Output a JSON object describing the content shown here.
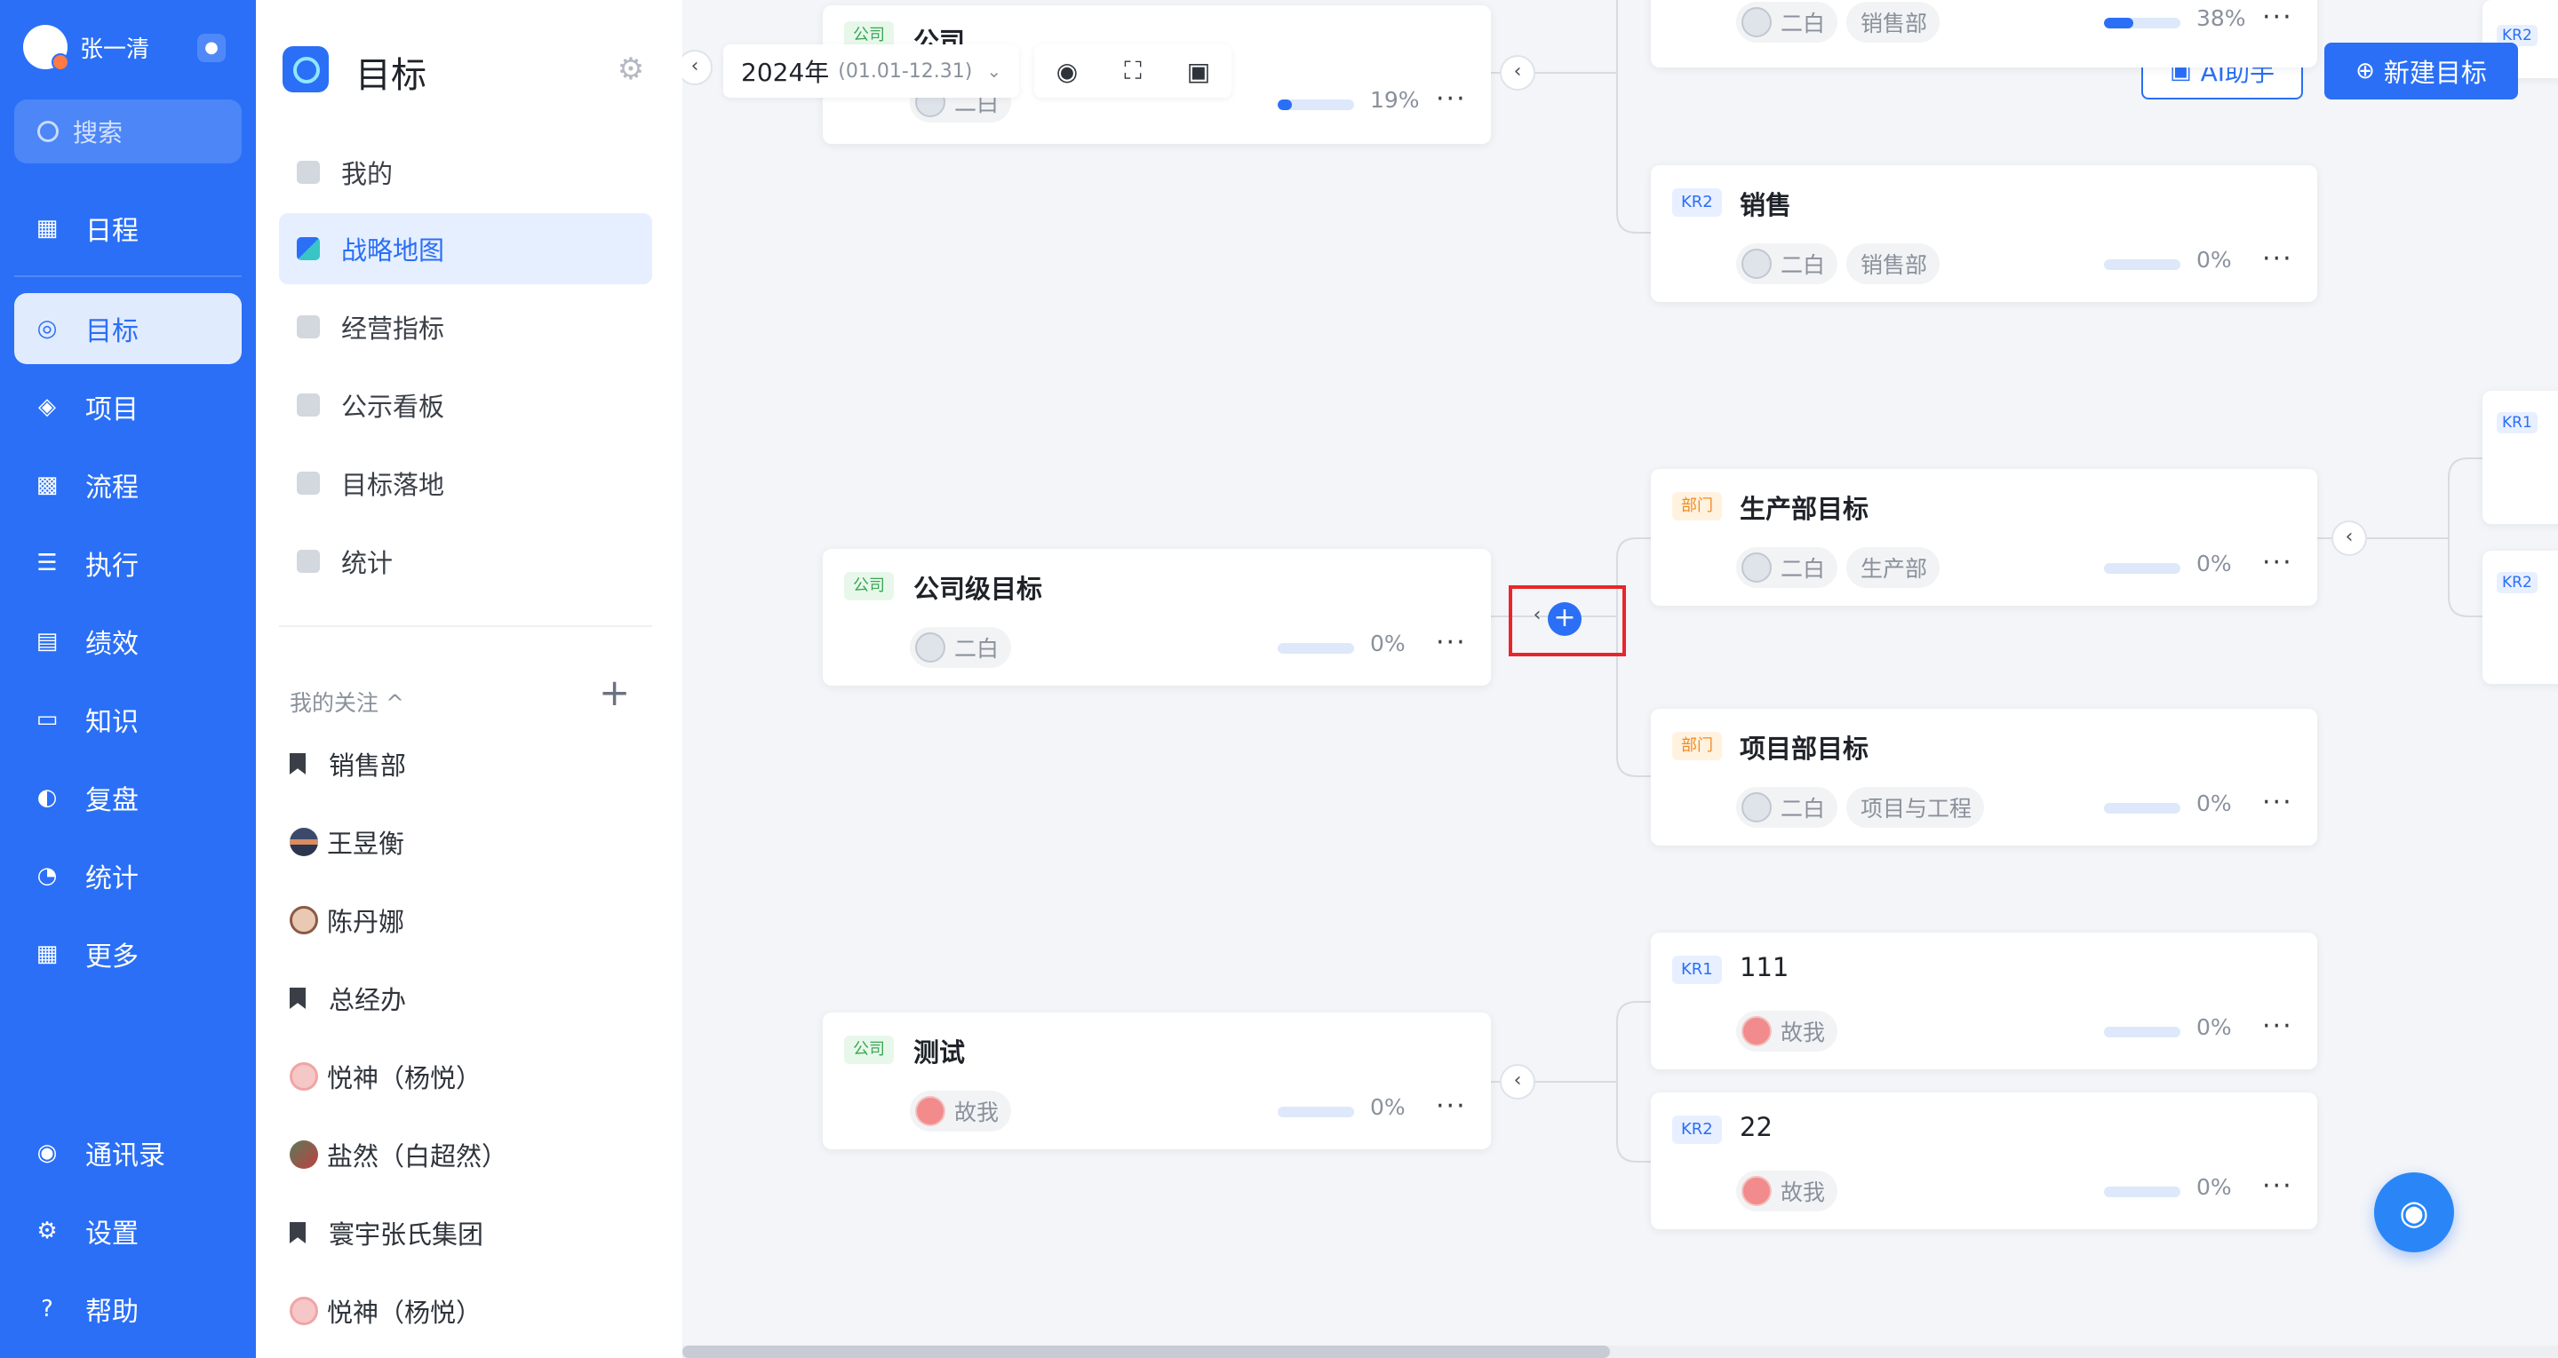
{
  "nav": {
    "user_name": "张一清",
    "search_placeholder": "搜索",
    "items": [
      {
        "label": "日程",
        "icon": "calendar-icon"
      },
      {
        "label": "目标",
        "icon": "target-icon"
      },
      {
        "label": "项目",
        "icon": "cube-icon"
      },
      {
        "label": "流程",
        "icon": "flow-icon"
      },
      {
        "label": "执行",
        "icon": "checklist-icon"
      },
      {
        "label": "绩效",
        "icon": "chart-icon"
      },
      {
        "label": "知识",
        "icon": "book-icon"
      },
      {
        "label": "复盘",
        "icon": "review-icon"
      },
      {
        "label": "统计",
        "icon": "pie-icon"
      },
      {
        "label": "更多",
        "icon": "grid-icon"
      }
    ],
    "bottom": [
      {
        "label": "通讯录",
        "icon": "contacts-icon"
      },
      {
        "label": "设置",
        "icon": "gear-icon"
      },
      {
        "label": "帮助",
        "icon": "help-icon"
      }
    ]
  },
  "sidebar": {
    "title": "目标",
    "items": [
      {
        "label": "我的"
      },
      {
        "label": "战略地图"
      },
      {
        "label": "经营指标"
      },
      {
        "label": "公示看板"
      },
      {
        "label": "目标落地"
      },
      {
        "label": "统计"
      }
    ],
    "follow_title": "我的关注 ^",
    "follows": [
      {
        "label": "销售部",
        "kind": "bookmark"
      },
      {
        "label": "王昱衡",
        "kind": "avatar"
      },
      {
        "label": "陈丹娜",
        "kind": "avatar"
      },
      {
        "label": "总经办",
        "kind": "bookmark"
      },
      {
        "label": "悦神（杨悦）",
        "kind": "avatar"
      },
      {
        "label": "盐然（白超然）",
        "kind": "avatar"
      },
      {
        "label": "寰宇张氏集团",
        "kind": "bookmark"
      },
      {
        "label": "悦神（杨悦）",
        "kind": "avatar"
      }
    ]
  },
  "toolbar": {
    "year": "2024年",
    "range": "(01.01-12.31)",
    "ai_label": "AI助手",
    "new_label": "新建目标"
  },
  "cards": {
    "top_company": {
      "tag": "公司",
      "title": "公司",
      "owner": "二白",
      "progress": 19,
      "progress_text": "19%"
    },
    "company_goal": {
      "tag": "公司",
      "title": "公司级目标",
      "owner": "二白",
      "progress": 0,
      "progress_text": "0%"
    },
    "test_goal": {
      "tag": "公司",
      "title": "测试",
      "owner": "故我",
      "progress": 0,
      "progress_text": "0%"
    },
    "top_kr": {
      "owner": "二白",
      "dept": "销售部",
      "progress": 38,
      "progress_text": "38%"
    },
    "sales_kr": {
      "tag": "KR2",
      "title": "销售",
      "owner": "二白",
      "dept": "销售部",
      "progress": 0,
      "progress_text": "0%"
    },
    "prod_dept": {
      "tag": "部门",
      "title": "生产部目标",
      "owner": "二白",
      "dept": "生产部",
      "progress": 0,
      "progress_text": "0%"
    },
    "proj_dept": {
      "tag": "部门",
      "title": "项目部目标",
      "owner": "二白",
      "dept": "项目与工程",
      "progress": 0,
      "progress_text": "0%"
    },
    "kr_111": {
      "tag": "KR1",
      "title": "111",
      "owner": "故我",
      "progress": 0,
      "progress_text": "0%"
    },
    "kr_22": {
      "tag": "KR2",
      "title": "22",
      "owner": "故我",
      "progress": 0,
      "progress_text": "0%"
    }
  },
  "edge_tags": {
    "kr1": "KR1",
    "kr2": "KR2"
  },
  "more_glyph": "···"
}
